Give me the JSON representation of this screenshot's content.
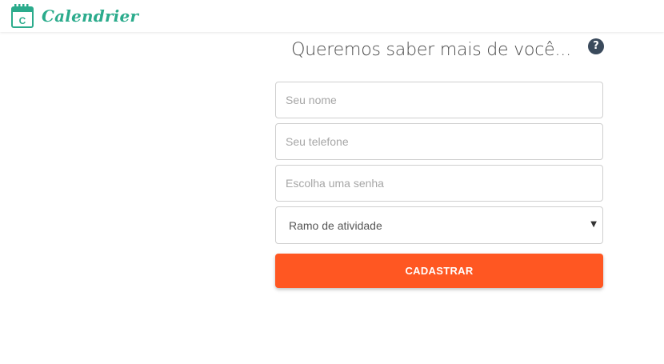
{
  "brand": {
    "name": "Calendrier",
    "icon_letter": "C",
    "color": "#2bab8c"
  },
  "help": {
    "icon": "question-circle-icon",
    "glyph": "?"
  },
  "form": {
    "title": "Queremos saber mais de você...",
    "name_placeholder": "Seu nome",
    "phone_placeholder": "Seu telefone",
    "password_placeholder": "Escolha uma senha",
    "activity_selected": "Ramo de atividade",
    "dropdown_arrow": "▼",
    "submit_label": "CADASTRAR",
    "submit_color": "#ff5722"
  }
}
